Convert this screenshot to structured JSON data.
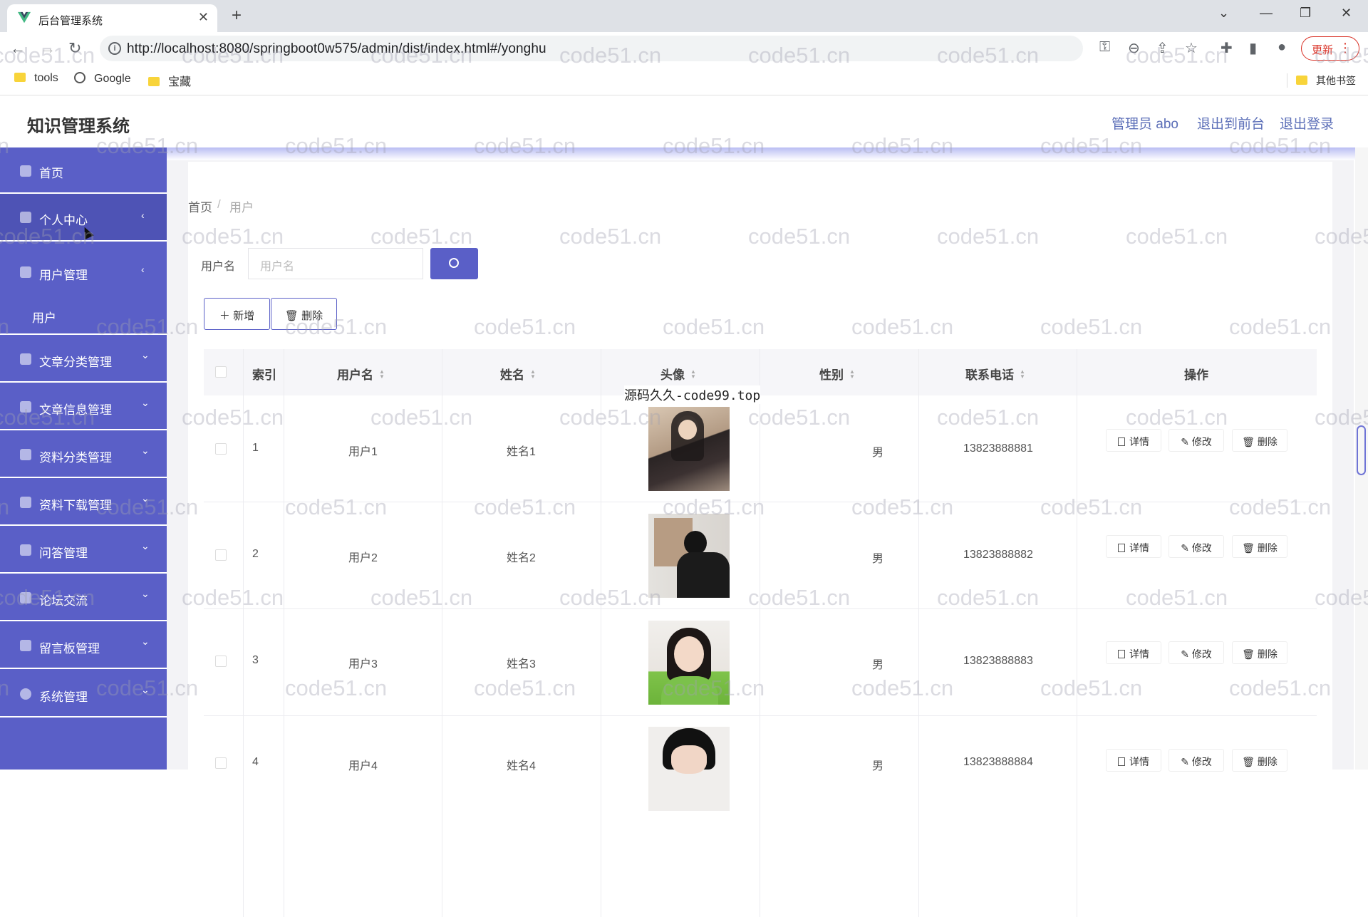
{
  "browser": {
    "tab_title": "后台管理系统",
    "url": "http://localhost:8080/springboot0w575/admin/dist/index.html#/yonghu",
    "update_label": "更新",
    "bookmarks": [
      "tools",
      "Google",
      "宝藏"
    ],
    "other_bookmarks": "其他书签"
  },
  "header": {
    "title": "知识管理系统",
    "admin_label": "管理员 abo",
    "to_front": "退出到前台",
    "logout": "退出登录"
  },
  "sidebar": {
    "items": [
      {
        "label": "首页",
        "icon": "home-icon"
      },
      {
        "label": "个人中心",
        "icon": "user-icon"
      },
      {
        "label": "用户管理",
        "icon": "send-icon"
      },
      {
        "label": "用户",
        "icon": ""
      },
      {
        "label": "文章分类管理",
        "icon": "flag-icon"
      },
      {
        "label": "文章信息管理",
        "icon": "check-icon"
      },
      {
        "label": "资料分类管理",
        "icon": "copy-icon"
      },
      {
        "label": "资料下载管理",
        "icon": "person-icon"
      },
      {
        "label": "问答管理",
        "icon": "clipboard-icon"
      },
      {
        "label": "论坛交流",
        "icon": "grid-icon"
      },
      {
        "label": "留言板管理",
        "icon": "monitor-icon"
      },
      {
        "label": "系统管理",
        "icon": "location-icon"
      }
    ]
  },
  "breadcrumb": {
    "home": "首页",
    "sep": "/",
    "current": "用户"
  },
  "search": {
    "label": "用户名",
    "placeholder": "用户名"
  },
  "actions": {
    "add": "新增",
    "delete": "删除"
  },
  "table": {
    "columns": [
      "索引",
      "用户名",
      "姓名",
      "头像",
      "性别",
      "联系电话",
      "操作"
    ],
    "row_actions": {
      "detail": "详情",
      "edit": "修改",
      "delete": "删除"
    },
    "rows": [
      {
        "index": "1",
        "username": "用户1",
        "name": "姓名1",
        "gender": "男",
        "phone": "13823888881"
      },
      {
        "index": "2",
        "username": "用户2",
        "name": "姓名2",
        "gender": "男",
        "phone": "13823888882"
      },
      {
        "index": "3",
        "username": "用户3",
        "name": "姓名3",
        "gender": "男",
        "phone": "13823888883"
      },
      {
        "index": "4",
        "username": "用户4",
        "name": "姓名4",
        "gender": "男",
        "phone": "13823888884"
      }
    ]
  },
  "overlay_text": "源码久久-code99.top",
  "watermark": "code51.cn",
  "colors": {
    "accent": "#5a5fc7",
    "link": "#5c6fb8"
  }
}
